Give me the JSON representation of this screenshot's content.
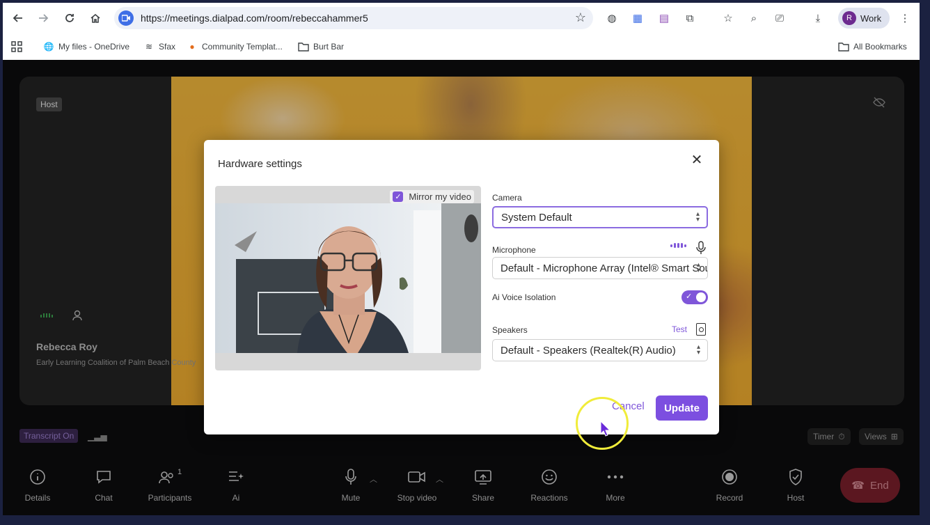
{
  "browser": {
    "url": "https://meetings.dialpad.com/room/rebeccahammer5",
    "profile_initial": "R",
    "profile_label": "Work",
    "bookmarks": [
      {
        "label": "My files - OneDrive",
        "icon": "globe-icon"
      },
      {
        "label": "Sfax",
        "icon": "sfax-icon"
      },
      {
        "label": "Community Templat...",
        "icon": "community-icon"
      },
      {
        "label": "Burt Bar",
        "icon": "folder-icon"
      }
    ],
    "all_bookmarks": "All Bookmarks"
  },
  "stage": {
    "host_badge": "Host",
    "participant_name": "Rebecca Roy",
    "participant_org": "Early Learning Coalition of Palm Beach County",
    "transcript_label": "Transcript On",
    "timer_label": "Timer",
    "views_label": "Views"
  },
  "controls": {
    "details": "Details",
    "chat": "Chat",
    "participants": "Participants",
    "participants_count": "1",
    "ai": "Ai",
    "mute": "Mute",
    "stop_video": "Stop video",
    "share": "Share",
    "reactions": "Reactions",
    "more": "More",
    "record": "Record",
    "host": "Host",
    "end": "End"
  },
  "modal": {
    "title": "Hardware settings",
    "mirror_label": "Mirror my video",
    "mirror_checked": true,
    "camera_label": "Camera",
    "camera_value": "System Default",
    "microphone_label": "Microphone",
    "microphone_value": "Default - Microphone Array (Intel® Smart Sound Technology)",
    "ai_voice_label": "Ai Voice Isolation",
    "ai_voice_on": true,
    "speakers_label": "Speakers",
    "test_label": "Test",
    "speakers_value": "Default - Speakers (Realtek(R) Audio)",
    "cancel_label": "Cancel",
    "update_label": "Update"
  },
  "colors": {
    "accent": "#7c4fe0",
    "end_button": "#7a1f2b",
    "click_highlight": "#f0ec3a"
  }
}
